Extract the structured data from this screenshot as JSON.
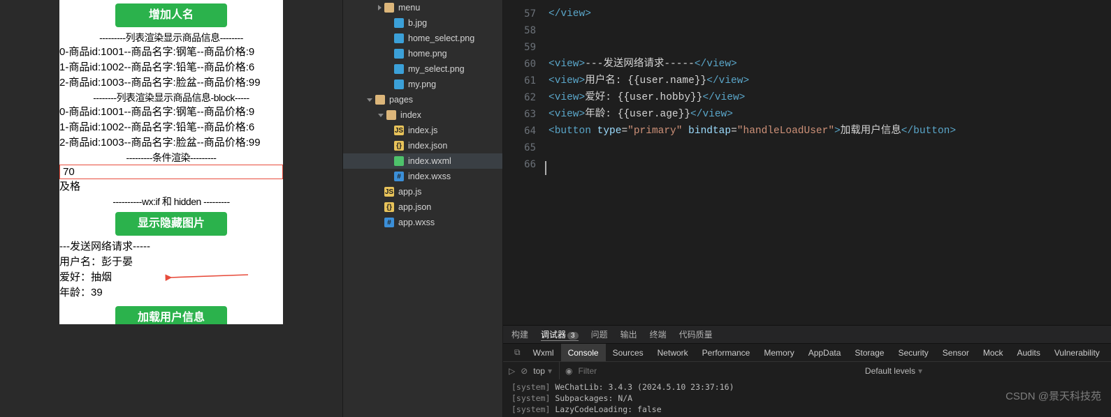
{
  "simulator": {
    "btn_add_name": "增加人名",
    "divider_list": "---------列表渲染显示商品信息--------",
    "products": [
      "0-商品id:1001--商品名字:钢笔--商品价格:9",
      "1-商品id:1002--商品名字:铅笔--商品价格:6",
      "2-商品id:1003--商品名字:脸盆--商品价格:99"
    ],
    "divider_block": "--------列表渲染显示商品信息-block-----",
    "products2": [
      "0-商品id:1001--商品名字:钢笔--商品价格:9",
      "1-商品id:1002--商品名字:铅笔--商品价格:6",
      "2-商品id:1003--商品名字:脸盆--商品价格:99"
    ],
    "divider_cond": "---------条件渲染---------",
    "input_value": "70",
    "grade_text": "及格",
    "divider_wxif": "----------wx:if 和 hidden ---------",
    "btn_toggle_img": "显示隐藏图片",
    "divider_net": "---发送网络请求-----",
    "user_name_row": "用户名：彭于晏",
    "hobby_row": "爱好：抽烟",
    "age_row": "年龄：39",
    "btn_load_user": "加载用户信息"
  },
  "tree": {
    "items": [
      {
        "indent": 50,
        "icon": "folder",
        "label": "menu",
        "chev": "right"
      },
      {
        "indent": 64,
        "icon": "img",
        "label": "b.jpg"
      },
      {
        "indent": 64,
        "icon": "img",
        "label": "home_select.png"
      },
      {
        "indent": 64,
        "icon": "img",
        "label": "home.png"
      },
      {
        "indent": 64,
        "icon": "img",
        "label": "my_select.png"
      },
      {
        "indent": 64,
        "icon": "img",
        "label": "my.png"
      },
      {
        "indent": 34,
        "icon": "folder",
        "label": "pages",
        "chev": "down"
      },
      {
        "indent": 50,
        "icon": "folder",
        "label": "index",
        "chev": "down"
      },
      {
        "indent": 64,
        "icon": "js",
        "label": "index.js"
      },
      {
        "indent": 64,
        "icon": "json",
        "label": "index.json"
      },
      {
        "indent": 64,
        "icon": "wxml",
        "label": "index.wxml",
        "active": true
      },
      {
        "indent": 64,
        "icon": "wxss",
        "label": "index.wxss"
      },
      {
        "indent": 50,
        "icon": "js",
        "label": "app.js"
      },
      {
        "indent": 50,
        "icon": "json",
        "label": "app.json"
      },
      {
        "indent": 50,
        "icon": "wxss",
        "label": "app.wxss"
      }
    ]
  },
  "editor": {
    "line_start": 57,
    "lines": [
      {
        "html": "</view>",
        "kind": "tag"
      },
      {
        "html": "",
        "kind": "blank"
      },
      {
        "html": "",
        "kind": "blank"
      },
      {
        "html": "<view>---发送网络请求-----</view>",
        "kind": "mix1"
      },
      {
        "html": "<view>用户名: {{user.name}}</view>",
        "kind": "mix2"
      },
      {
        "html": "<view>爱好: {{user.hobby}}</view>",
        "kind": "mix3"
      },
      {
        "html": "<view>年龄: {{user.age}}</view>",
        "kind": "mix4"
      },
      {
        "html": "<button type=\"primary\" bindtap=\"handleLoadUser\">加载用户信息</button>",
        "kind": "mix5"
      },
      {
        "html": "",
        "kind": "blank"
      },
      {
        "html": "",
        "kind": "blank"
      }
    ]
  },
  "devtools": {
    "sub_tabs": [
      "构建",
      "调试器",
      "问题",
      "输出",
      "终端",
      "代码质量"
    ],
    "sub_badge": "3",
    "tabs": [
      "Wxml",
      "Console",
      "Sources",
      "Network",
      "Performance",
      "Memory",
      "AppData",
      "Storage",
      "Security",
      "Sensor",
      "Mock",
      "Audits",
      "Vulnerability"
    ],
    "active_tab": "Console",
    "filter": {
      "context": "top",
      "placeholder": "Filter",
      "levels": "Default levels"
    },
    "console_lines": [
      "[system] WeChatLib: 3.4.3 (2024.5.10 23:37:16)",
      "[system] Subpackages: N/A",
      "[system] LazyCodeLoading: false"
    ]
  },
  "watermark": "CSDN @景天科技苑"
}
